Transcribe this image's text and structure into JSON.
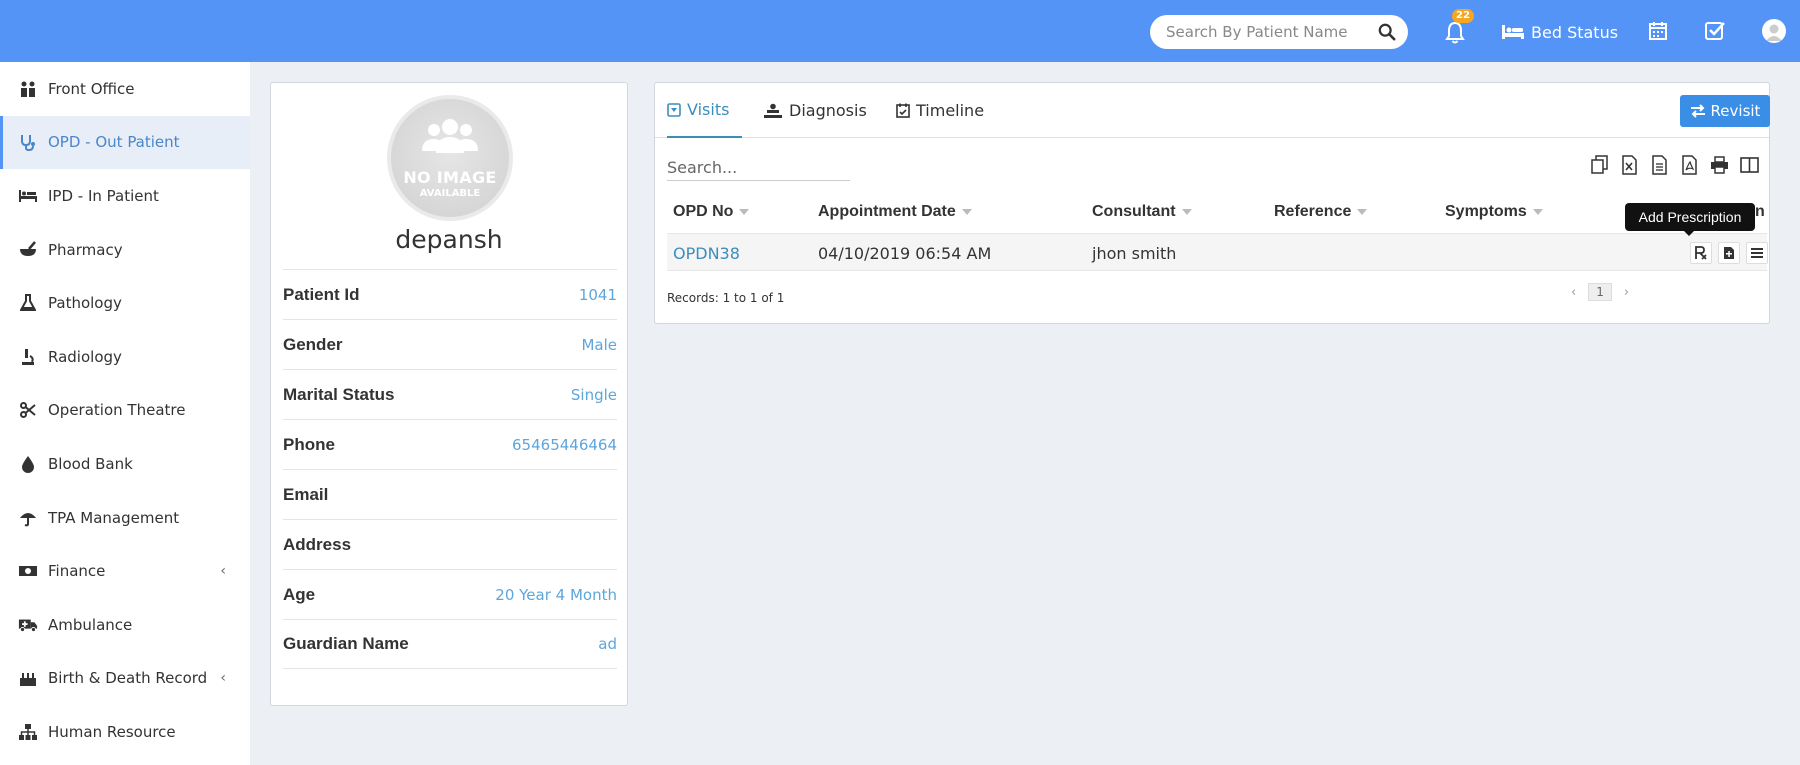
{
  "header": {
    "search_placeholder": "Search By Patient Name",
    "notification_count": "22",
    "bed_status_label": "Bed Status"
  },
  "sidebar": {
    "items": [
      {
        "label": "Front Office"
      },
      {
        "label": "OPD - Out Patient"
      },
      {
        "label": "IPD - In Patient"
      },
      {
        "label": "Pharmacy"
      },
      {
        "label": "Pathology"
      },
      {
        "label": "Radiology"
      },
      {
        "label": "Operation Theatre"
      },
      {
        "label": "Blood Bank"
      },
      {
        "label": "TPA Management"
      },
      {
        "label": "Finance"
      },
      {
        "label": "Ambulance"
      },
      {
        "label": "Birth & Death Record"
      },
      {
        "label": "Human Resource"
      }
    ]
  },
  "patient": {
    "no_image_line1": "NO IMAGE",
    "no_image_line2": "AVAILABLE",
    "name": "depansh",
    "fields": [
      {
        "label": "Patient Id",
        "value": "1041"
      },
      {
        "label": "Gender",
        "value": "Male"
      },
      {
        "label": "Marital Status",
        "value": "Single"
      },
      {
        "label": "Phone",
        "value": "65465446464"
      },
      {
        "label": "Email",
        "value": ""
      },
      {
        "label": "Address",
        "value": ""
      },
      {
        "label": "Age",
        "value": "20 Year 4 Month"
      },
      {
        "label": "Guardian Name",
        "value": "ad"
      }
    ]
  },
  "visits": {
    "tabs": [
      {
        "label": "Visits"
      },
      {
        "label": "Diagnosis"
      },
      {
        "label": "Timeline"
      }
    ],
    "revisit_label": "Revisit",
    "search_placeholder": "Search...",
    "columns": [
      "OPD No",
      "Appointment Date",
      "Consultant",
      "Reference",
      "Symptoms",
      "n"
    ],
    "rows": [
      {
        "opd_no": "OPDN38",
        "date": "04/10/2019 06:54 AM",
        "consultant": "jhon smith",
        "reference": "",
        "symptoms": ""
      }
    ],
    "tooltip": "Add Prescription",
    "records": "Records: 1 to 1 of 1",
    "page": "1"
  },
  "colors": {
    "topbar": "#5394f6",
    "link": "#3c8dbc",
    "value": "#5da6dc",
    "badge": "#f5a623"
  }
}
